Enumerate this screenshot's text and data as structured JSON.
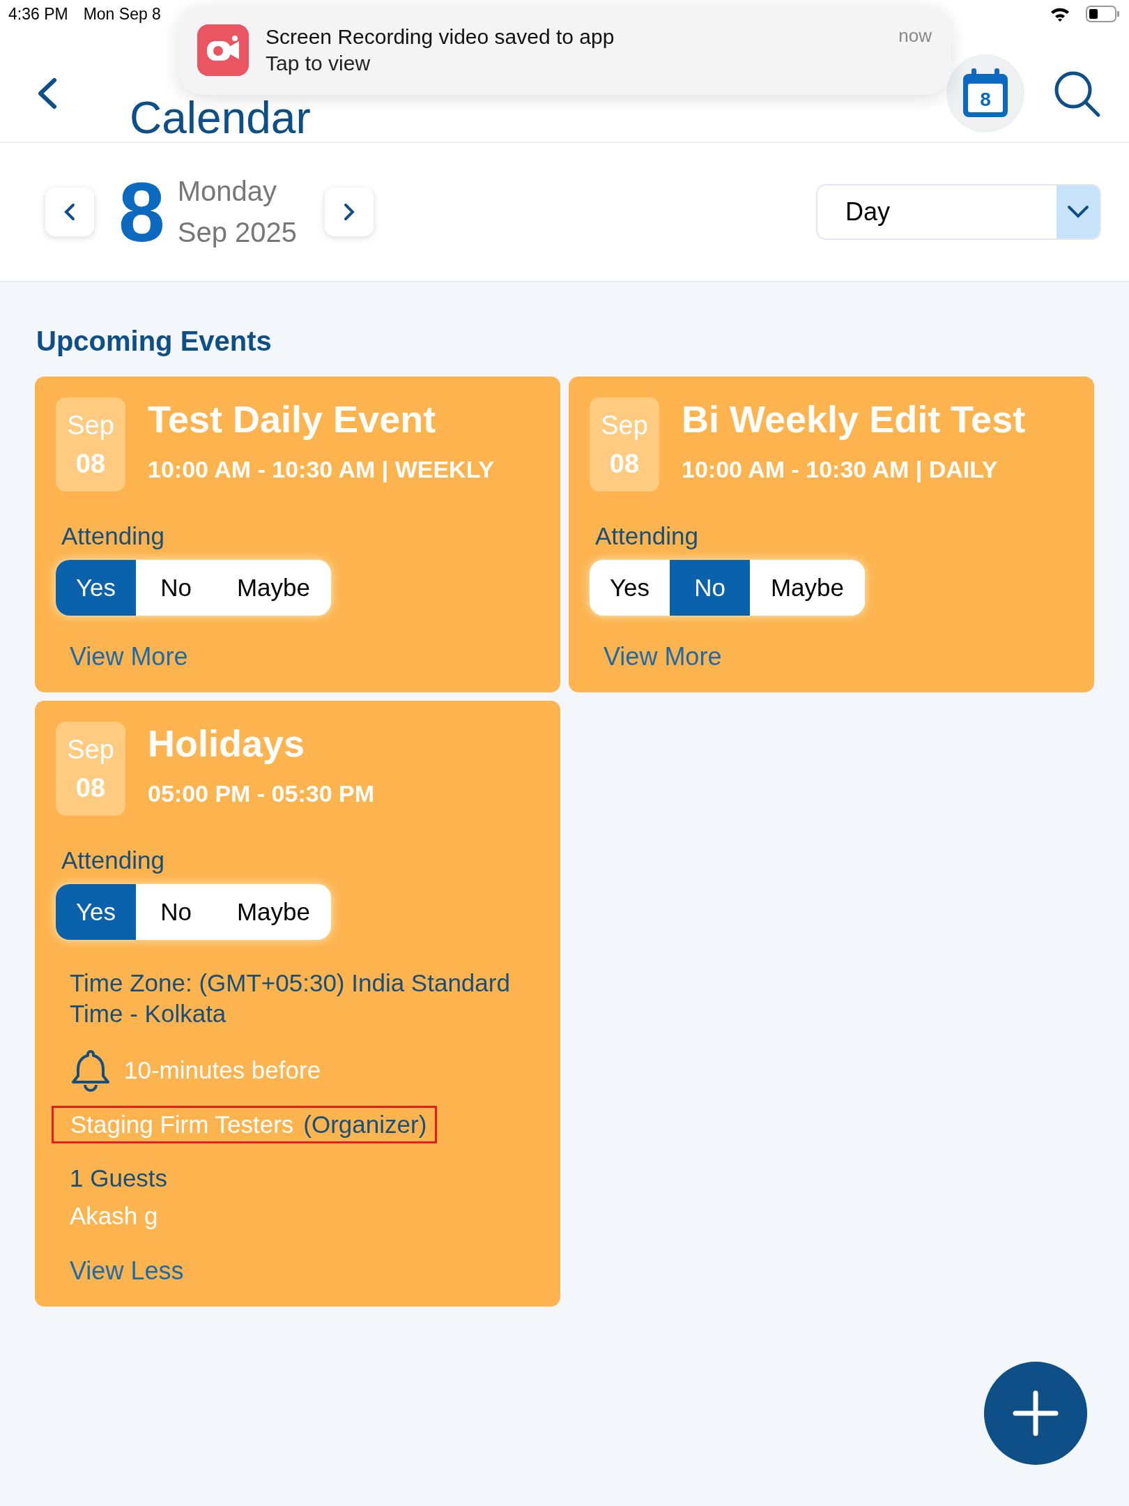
{
  "status_bar": {
    "time": "4:36 PM",
    "date": "Mon Sep 8"
  },
  "notification": {
    "title": "Screen Recording video saved to app",
    "subtitle": "Tap to view",
    "time": "now"
  },
  "header": {
    "title": "Calendar",
    "calendar_badge": "8"
  },
  "date_nav": {
    "day": "8",
    "weekday": "Monday",
    "month_year": "Sep 2025",
    "view": "Day"
  },
  "section_title": "Upcoming Events",
  "events": [
    {
      "month": "Sep",
      "day": "08",
      "title": "Test Daily Event",
      "time": "10:00 AM - 10:30 AM | WEEKLY",
      "attending_label": "Attending",
      "options": [
        {
          "label": "Yes",
          "selected": true
        },
        {
          "label": "No",
          "selected": false
        },
        {
          "label": "Maybe",
          "selected": false
        }
      ],
      "link": "View More"
    },
    {
      "month": "Sep",
      "day": "08",
      "title": "Bi Weekly Edit Test",
      "time": "10:00 AM - 10:30 AM | DAILY",
      "attending_label": "Attending",
      "options": [
        {
          "label": "Yes",
          "selected": false
        },
        {
          "label": "No",
          "selected": true
        },
        {
          "label": "Maybe",
          "selected": false
        }
      ],
      "link": "View More"
    },
    {
      "month": "Sep",
      "day": "08",
      "title": "Holidays",
      "time": "05:00 PM - 05:30 PM",
      "attending_label": "Attending",
      "options": [
        {
          "label": "Yes",
          "selected": true
        },
        {
          "label": "No",
          "selected": false
        },
        {
          "label": "Maybe",
          "selected": false
        }
      ],
      "details": {
        "time_zone": "Time Zone: (GMT+05:30) India Standard Time - Kolkata",
        "reminder": "10-minutes before",
        "organizer_name": "Staging Firm Testers",
        "organizer_role": "(Organizer)",
        "organizer_highlighted": true,
        "guests_count": "1 Guests",
        "guests": [
          "Akash g"
        ]
      },
      "link": "View Less"
    }
  ]
}
